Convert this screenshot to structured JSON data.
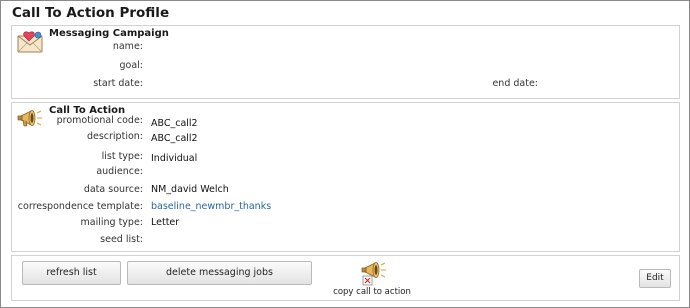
{
  "page": {
    "title": "Call To Action Profile"
  },
  "campaign": {
    "heading": "Messaging Campaign",
    "icon": "envelope-icon",
    "fields": {
      "name_label": "name:",
      "name_value": "",
      "goal_label": "goal:",
      "goal_value": "",
      "start_label": "start date:",
      "start_value": "",
      "end_label": "end date:",
      "end_value": ""
    }
  },
  "cta": {
    "heading": "Call To Action",
    "icon": "megaphone-icon",
    "rows": [
      {
        "label": "promotional code:",
        "value": "ABC_call2"
      },
      {
        "label": "description:",
        "value": "ABC_call2"
      },
      {
        "label": "list type:",
        "value": "Individual"
      },
      {
        "label": "audience:",
        "value": ""
      },
      {
        "label": "data source:",
        "value": "NM_david Welch"
      },
      {
        "label": "correspondence template:",
        "value": "baseline_newmbr_thanks"
      },
      {
        "label": "mailing type:",
        "value": "Letter"
      },
      {
        "label": "seed list:",
        "value": ""
      }
    ]
  },
  "actions": {
    "refresh_label": "refresh list",
    "delete_label": "delete messaging jobs",
    "copy_label": "copy call to action",
    "copy_icon": "megaphone-copy-icon",
    "edit_label": "Edit"
  },
  "colors": {
    "link": "#2868a8",
    "panel_border": "#d2d2d2",
    "frame_border": "#8a8a8a"
  }
}
